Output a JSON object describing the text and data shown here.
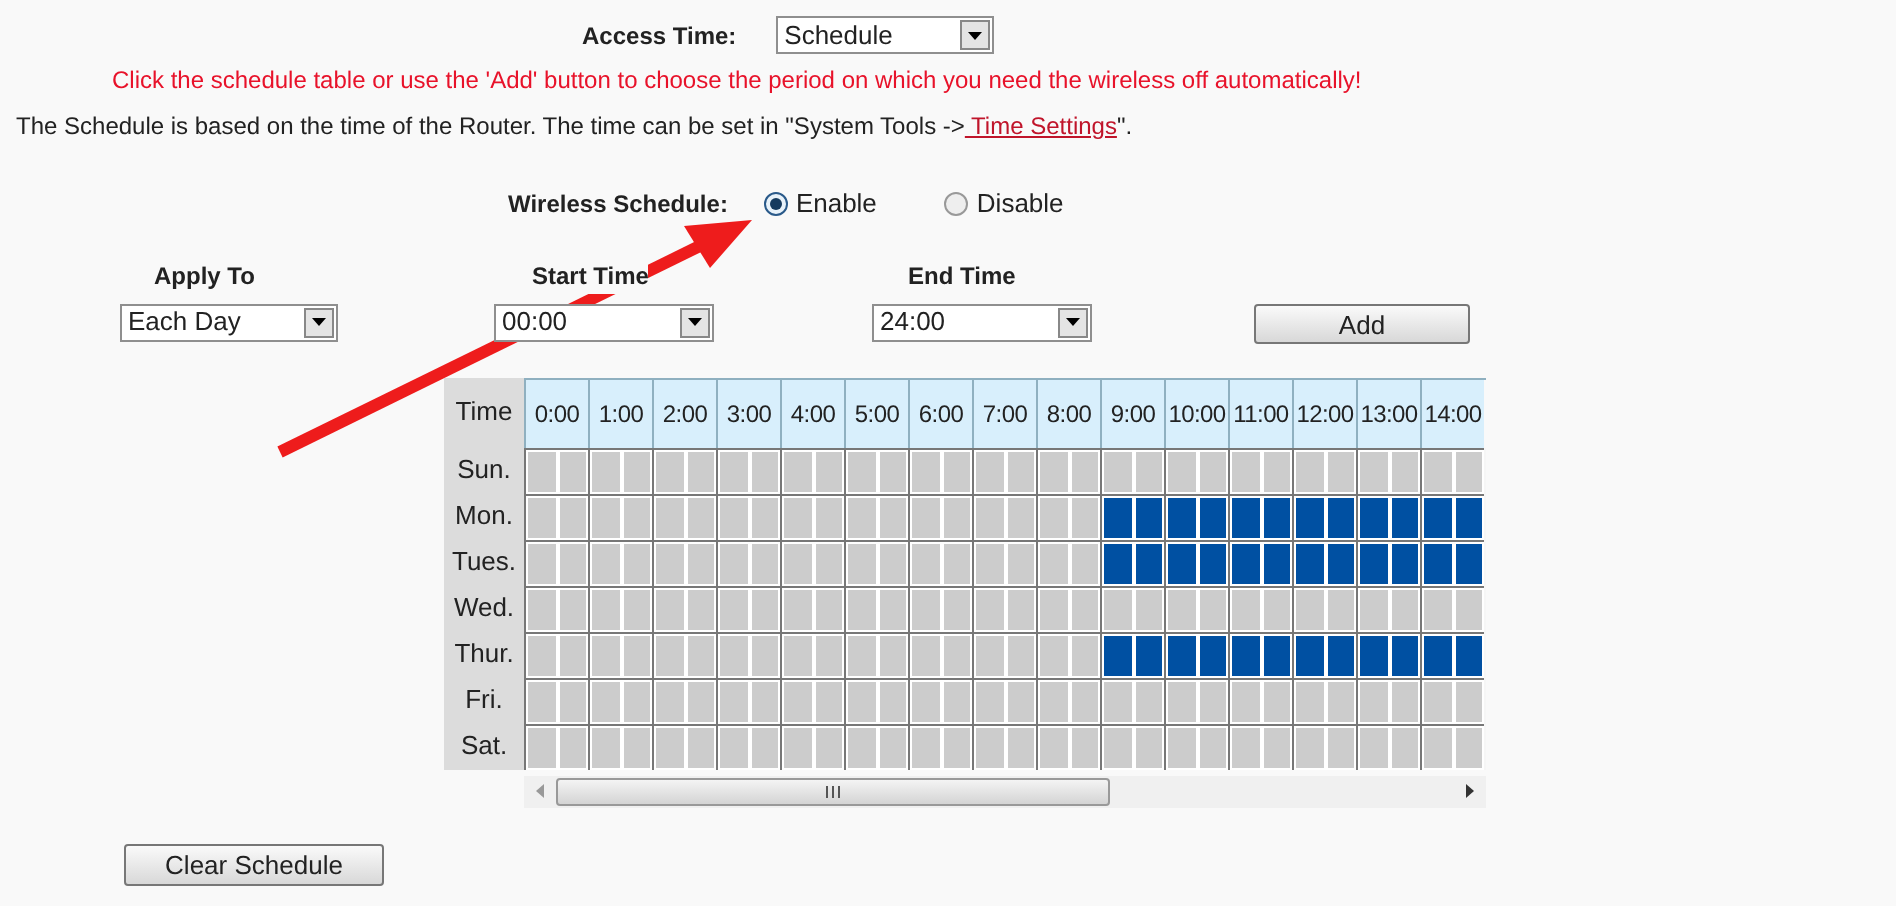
{
  "access_time": {
    "label": "Access Time:",
    "value": "Schedule"
  },
  "hint": "Click the schedule table or use the 'Add' button to choose the period on which you need the wireless off automatically!",
  "note": {
    "prefix": "The Schedule is based on the time of the Router. The time can be set in \"System Tools ->",
    "link": " Time Settings",
    "suffix": "\"."
  },
  "wireless_schedule": {
    "label": "Wireless Schedule:",
    "options": [
      {
        "label": "Enable",
        "selected": true
      },
      {
        "label": "Disable",
        "selected": false
      }
    ]
  },
  "fields": [
    {
      "label": "Apply To",
      "value": "Each Day"
    },
    {
      "label": "Start Time",
      "value": "00:00"
    },
    {
      "label": "End Time",
      "value": "24:00"
    }
  ],
  "add_button": "Add",
  "schedule": {
    "corner": "Time",
    "hours": [
      "0:00",
      "1:00",
      "2:00",
      "3:00",
      "4:00",
      "5:00",
      "6:00",
      "7:00",
      "8:00",
      "9:00",
      "10:00",
      "11:00",
      "12:00",
      "13:00",
      "14:00"
    ],
    "rows": [
      {
        "day": "Sun.",
        "slots": [
          false,
          false,
          false,
          false,
          false,
          false,
          false,
          false,
          false,
          false,
          false,
          false,
          false,
          false,
          false,
          false,
          false,
          false,
          false,
          false,
          false,
          false,
          false,
          false,
          false,
          false,
          false,
          false,
          false,
          false
        ]
      },
      {
        "day": "Mon.",
        "slots": [
          false,
          false,
          false,
          false,
          false,
          false,
          false,
          false,
          false,
          false,
          false,
          false,
          false,
          false,
          false,
          false,
          false,
          false,
          true,
          true,
          true,
          true,
          true,
          true,
          true,
          true,
          true,
          true,
          true,
          true
        ]
      },
      {
        "day": "Tues.",
        "slots": [
          false,
          false,
          false,
          false,
          false,
          false,
          false,
          false,
          false,
          false,
          false,
          false,
          false,
          false,
          false,
          false,
          false,
          false,
          true,
          true,
          true,
          true,
          true,
          true,
          true,
          true,
          true,
          true,
          true,
          true
        ]
      },
      {
        "day": "Wed.",
        "slots": [
          false,
          false,
          false,
          false,
          false,
          false,
          false,
          false,
          false,
          false,
          false,
          false,
          false,
          false,
          false,
          false,
          false,
          false,
          false,
          false,
          false,
          false,
          false,
          false,
          false,
          false,
          false,
          false,
          false,
          false
        ]
      },
      {
        "day": "Thur.",
        "slots": [
          false,
          false,
          false,
          false,
          false,
          false,
          false,
          false,
          false,
          false,
          false,
          false,
          false,
          false,
          false,
          false,
          false,
          false,
          true,
          true,
          true,
          true,
          true,
          true,
          true,
          true,
          true,
          true,
          true,
          true
        ]
      },
      {
        "day": "Fri.",
        "slots": [
          false,
          false,
          false,
          false,
          false,
          false,
          false,
          false,
          false,
          false,
          false,
          false,
          false,
          false,
          false,
          false,
          false,
          false,
          false,
          false,
          false,
          false,
          false,
          false,
          false,
          false,
          false,
          false,
          false,
          false
        ]
      },
      {
        "day": "Sat.",
        "slots": [
          false,
          false,
          false,
          false,
          false,
          false,
          false,
          false,
          false,
          false,
          false,
          false,
          false,
          false,
          false,
          false,
          false,
          false,
          false,
          false,
          false,
          false,
          false,
          false,
          false,
          false,
          false,
          false,
          false,
          false
        ]
      }
    ]
  },
  "clear_button": "Clear Schedule"
}
